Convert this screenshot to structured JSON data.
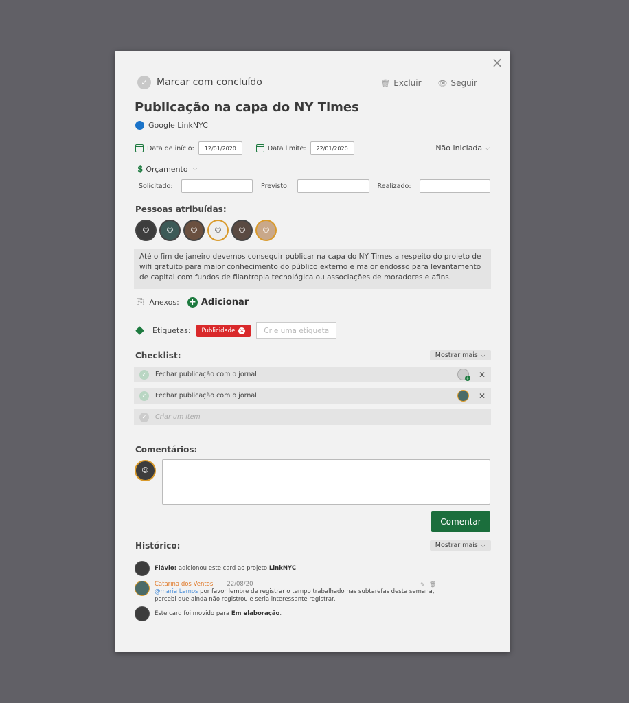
{
  "header": {
    "mark_done": "Marcar com concluído",
    "delete": "Excluir",
    "follow": "Seguir",
    "close": "×"
  },
  "task": {
    "title": "Publicação na capa do NY Times",
    "client": "Google LinkNYC",
    "start_label": "Data de início:",
    "start_value": "12/01/2020",
    "due_label": "Data limite:",
    "due_value": "22/01/2020",
    "status": "Não iniciada"
  },
  "budget": {
    "label": "Orçamento",
    "requested": "Solicitado:",
    "planned": "Previsto:",
    "realized": "Realizado:"
  },
  "people": {
    "title": "Pessoas atribuídas:",
    "avatars": [
      "avatar-1",
      "avatar-2",
      "avatar-3",
      "avatar-4",
      "avatar-5",
      "avatar-6"
    ]
  },
  "description": "Até o fim de janeiro devemos conseguir publicar na capa do NY Times a respeito do projeto de wifi gratuito para maior conhecimento do público externo e maior endosso para levantamento de capital com fundos de filantropia tecnológica ou associações de moradores e afins.",
  "attachments": {
    "label": "Anexos:",
    "add": "Adicionar"
  },
  "tags": {
    "label": "Etiquetas:",
    "items": [
      "Publicidade"
    ],
    "placeholder": "Crie uma etiqueta"
  },
  "checklist": {
    "title": "Checklist:",
    "more": "Mostrar mais",
    "items": [
      {
        "text": "Fechar publicação com o jornal"
      },
      {
        "text": "Fechar publicação com o jornal"
      }
    ],
    "create_placeholder": "Criar um item"
  },
  "comments": {
    "title": "Comentários:",
    "button": "Comentar"
  },
  "history": {
    "title": "Histórico:",
    "more": "Mostrar mais",
    "entry1_user": "Flávio:",
    "entry1_text": " adicionou este card ao projeto ",
    "entry1_project": "LinkNYC",
    "entry1_end": ".",
    "entry2_name": "Catarina dos Ventos",
    "entry2_date": "22/08/20",
    "entry2_mention": "@maria Lemos",
    "entry2_text": " por favor lembre de registrar o tempo trabalhado nas subtarefas desta semana, percebi que ainda não registrou e seria interessante registrar.",
    "entry3_text": "Este card foi movido para ",
    "entry3_target": "Em elaboração",
    "entry3_end": "."
  }
}
